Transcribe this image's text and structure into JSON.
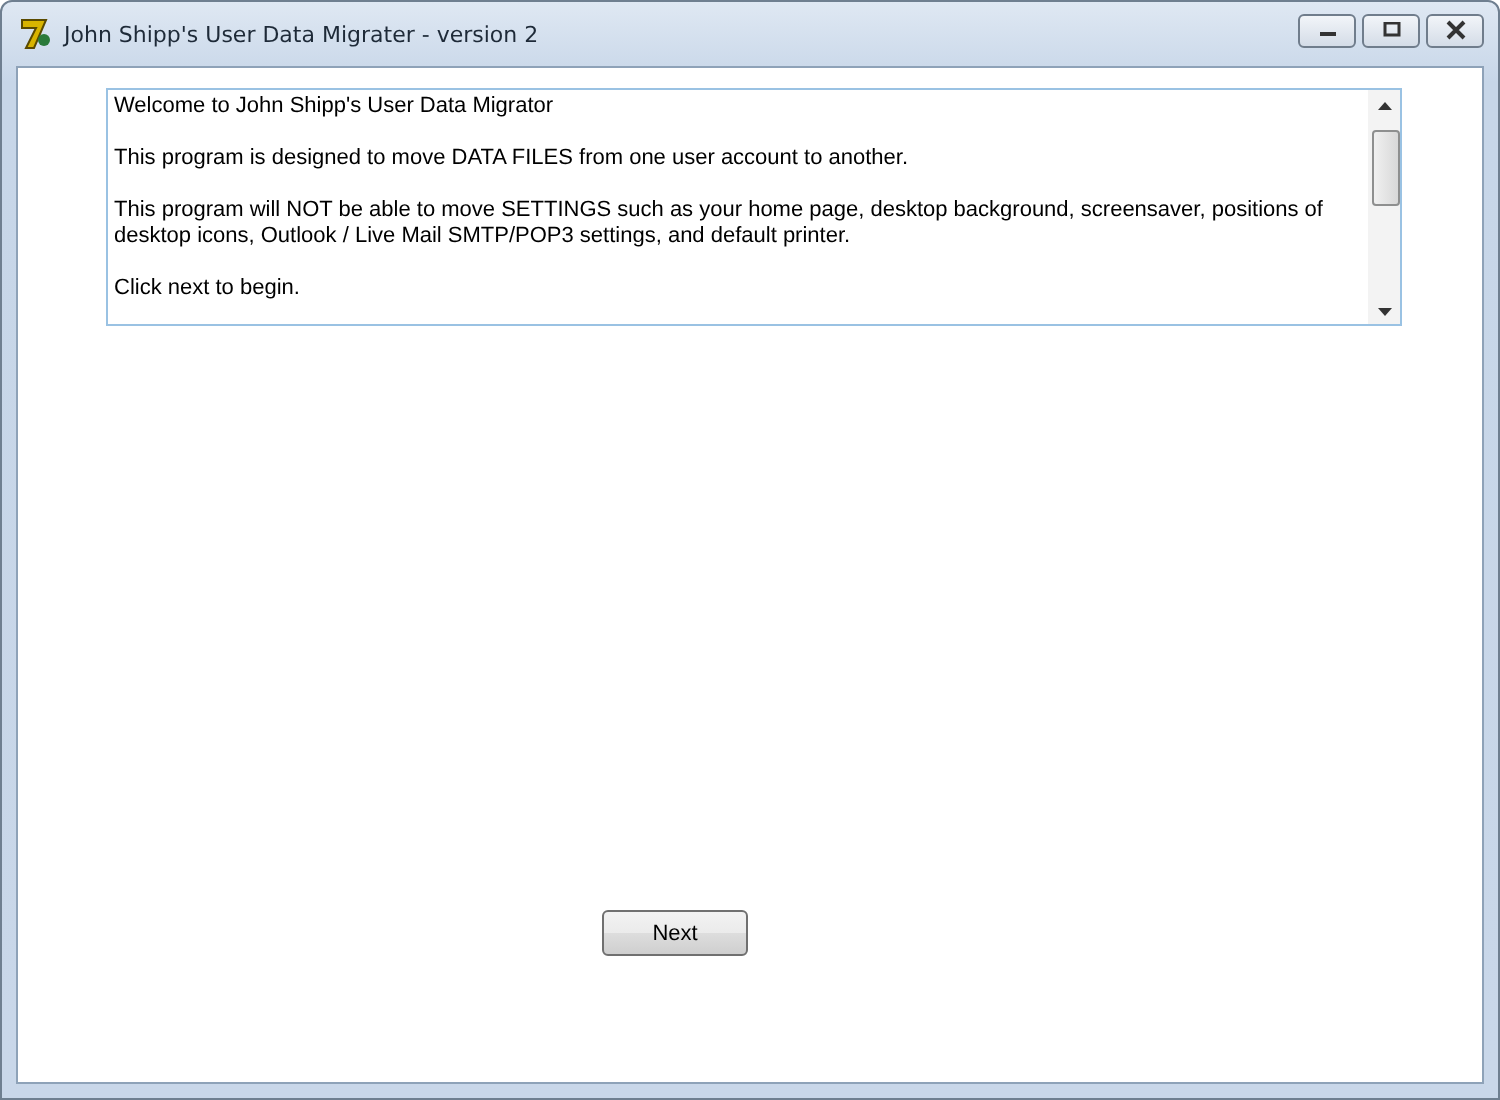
{
  "window": {
    "title": "John Shipp's User Data Migrater - version 2"
  },
  "message": {
    "paragraphs": [
      "Welcome to John Shipp's User Data Migrator",
      "This program is designed to move DATA FILES from one user account to another.",
      "This program will NOT be able to move SETTINGS such as your home page, desktop background, screensaver, positions of desktop icons, Outlook / Live Mail SMTP/POP3 settings, and default printer.",
      "Click next to begin."
    ]
  },
  "buttons": [
    {
      "label": "Next"
    }
  ]
}
